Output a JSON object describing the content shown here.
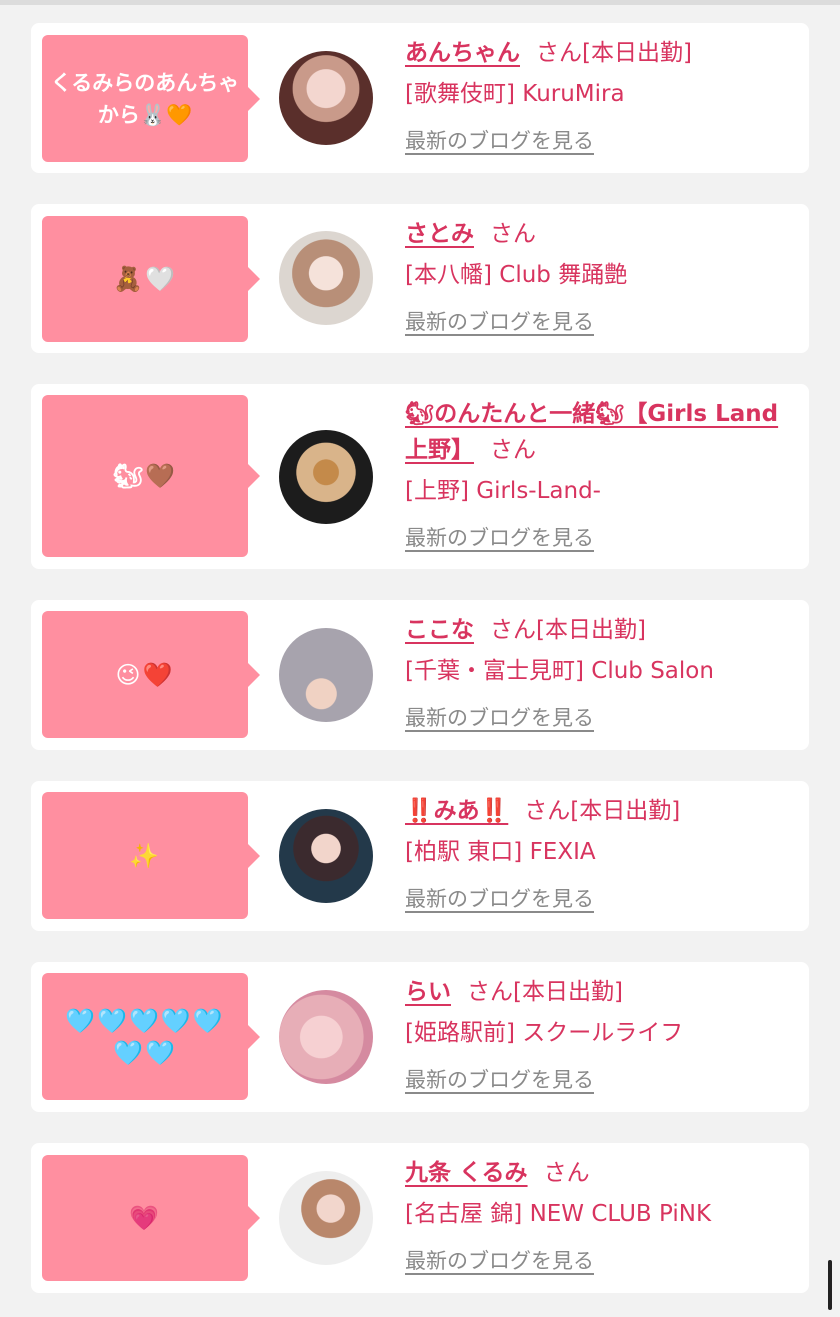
{
  "entries": [
    {
      "bubble": "くるみらのあんちゃから🐰🧡",
      "name": "あんちゃん",
      "san": "さん",
      "status": "[本日出勤]",
      "shop": "[歌舞伎町] KuruMira",
      "blog": "最新のブログを見る"
    },
    {
      "bubble": "🧸🤍",
      "name": "さとみ",
      "san": "さん",
      "status": "",
      "shop": "[本八幡] Club 舞踊艶",
      "blog": "最新のブログを見る"
    },
    {
      "bubble": "🐿🤎",
      "name": "🐿のんたんと一緒🐿【Girls Land上野】",
      "san": "さん",
      "status": "",
      "shop": "[上野] Girls-Land-",
      "blog": "最新のブログを見る"
    },
    {
      "bubble": "😉❤️",
      "name": "ここな",
      "san": "さん",
      "status": "[本日出勤]",
      "shop": "[千葉・富士見町] Club Salon",
      "blog": "最新のブログを見る"
    },
    {
      "bubble": "✨",
      "name": "‼️みあ‼️",
      "san": "さん",
      "status": "[本日出勤]",
      "shop": "[柏駅 東口] FEXIA",
      "blog": "最新のブログを見る"
    },
    {
      "bubble": "🩵🩵🩵🩵🩵🩵🩵",
      "name": "らい",
      "san": "さん",
      "status": "[本日出勤]",
      "shop": "[姫路駅前] スクールライフ",
      "blog": "最新のブログを見る"
    },
    {
      "bubble": "💗",
      "name": "九条 くるみ",
      "san": "さん",
      "status": "",
      "shop": "[名古屋 錦] NEW CLUB PiNK",
      "blog": "最新のブログを見る"
    }
  ],
  "colors": {
    "bubble": "#ff8fa0",
    "accent": "#d8345f",
    "link_gray": "#8a8a8a",
    "background": "#f2f2f2"
  }
}
